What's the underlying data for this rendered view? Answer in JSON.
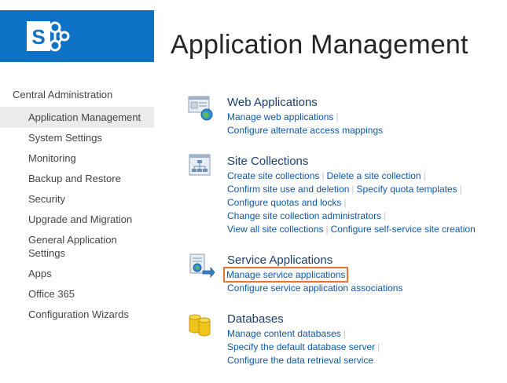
{
  "page": {
    "title": "Application Management"
  },
  "nav": {
    "root": "Central Administration",
    "items": [
      {
        "label": "Application Management",
        "selected": true
      },
      {
        "label": "System Settings"
      },
      {
        "label": "Monitoring"
      },
      {
        "label": "Backup and Restore"
      },
      {
        "label": "Security"
      },
      {
        "label": "Upgrade and Migration"
      },
      {
        "label": "General Application Settings"
      },
      {
        "label": "Apps"
      },
      {
        "label": "Office 365"
      },
      {
        "label": "Configuration Wizards"
      }
    ]
  },
  "sections": {
    "web": {
      "title": "Web Applications",
      "icon": "web-applications-icon",
      "links": [
        "Manage web applications",
        "Configure alternate access mappings"
      ]
    },
    "site": {
      "title": "Site Collections",
      "icon": "site-collections-icon",
      "links": [
        "Create site collections",
        "Delete a site collection",
        "Confirm site use and deletion",
        "Specify quota templates",
        "Configure quotas and locks",
        "Change site collection administrators",
        "View all site collections",
        "Configure self-service site creation"
      ]
    },
    "service": {
      "title": "Service Applications",
      "icon": "service-applications-icon",
      "links": [
        "Manage service applications",
        "Configure service application associations"
      ]
    },
    "db": {
      "title": "Databases",
      "icon": "databases-icon",
      "links": [
        "Manage content databases",
        "Specify the default database server",
        "Configure the data retrieval service"
      ]
    }
  },
  "colors": {
    "brand": "#0d72c6",
    "link": "#0f58a8",
    "highlight": "#e8752e"
  }
}
